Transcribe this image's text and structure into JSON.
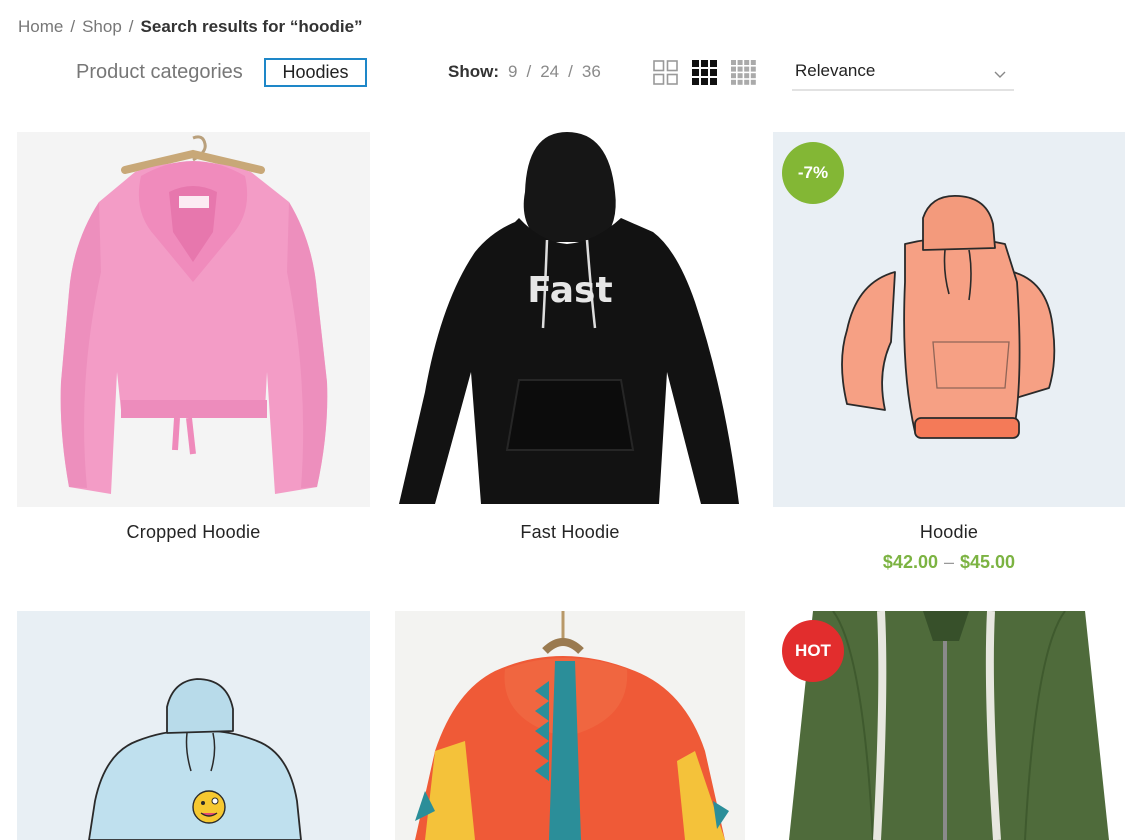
{
  "breadcrumb": {
    "home": "Home",
    "shop": "Shop",
    "sep": "/",
    "current": "Search results for “hoodie”"
  },
  "filters": {
    "categories_label": "Product categories",
    "active_category": "Hoodies"
  },
  "show": {
    "label": "Show",
    "colon": ":",
    "options": [
      "9",
      "24",
      "36"
    ],
    "sep": "/"
  },
  "view_options": [
    "grid-2-icon",
    "grid-3-icon",
    "grid-4-icon"
  ],
  "sort": {
    "selected": "Relevance"
  },
  "colors": {
    "accent": "#1e87c8",
    "price": "#7cb342",
    "badge_sale": "#83b735",
    "badge_hot": "#e22d2d"
  },
  "products": [
    {
      "title": "Cropped Hoodie",
      "price_from": "",
      "price_sep": "",
      "price_to": "",
      "badge": ""
    },
    {
      "title": "Fast Hoodie",
      "price_from": "",
      "price_sep": "",
      "price_to": "",
      "badge": "",
      "print_text": "Fast"
    },
    {
      "title": "Hoodie",
      "price_from": "$42.00",
      "price_sep": "–",
      "price_to": "$45.00",
      "badge": "-7%"
    },
    {
      "title": "",
      "badge": ""
    },
    {
      "title": "",
      "badge": ""
    },
    {
      "title": "",
      "badge": "HOT"
    }
  ]
}
